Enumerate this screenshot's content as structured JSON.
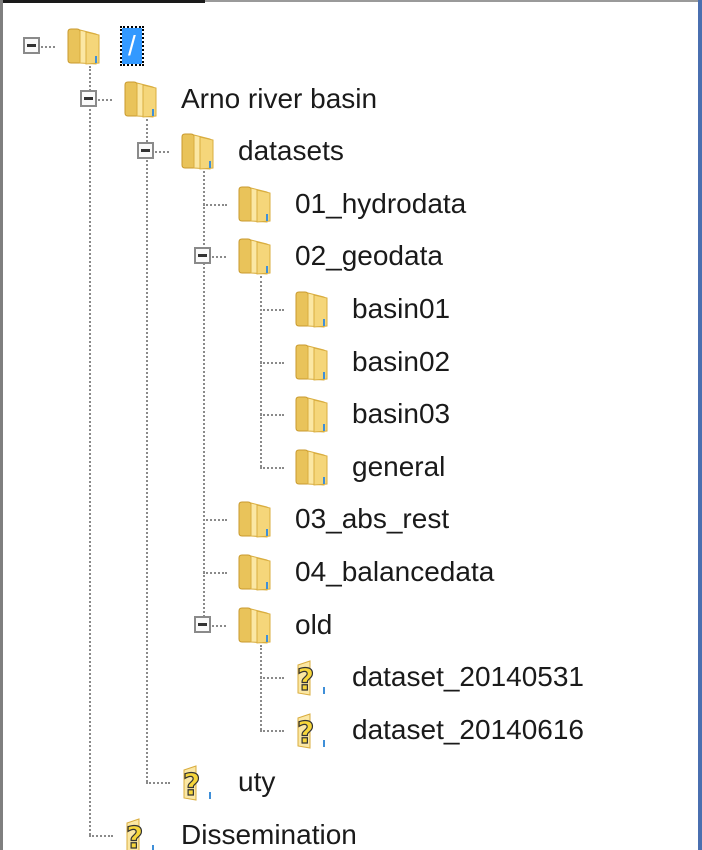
{
  "tree": {
    "nodes": [
      {
        "id": "root",
        "label": "/",
        "depth": 0,
        "icon": "folder",
        "expanded": true,
        "selected": true
      },
      {
        "id": "arno",
        "label": "Arno river basin",
        "depth": 1,
        "icon": "folder",
        "expanded": true
      },
      {
        "id": "datasets",
        "label": "datasets",
        "depth": 2,
        "icon": "folder",
        "expanded": true
      },
      {
        "id": "hydrodata",
        "label": "01_hydrodata",
        "depth": 3,
        "icon": "folder"
      },
      {
        "id": "geodata",
        "label": "02_geodata",
        "depth": 3,
        "icon": "folder",
        "expanded": true
      },
      {
        "id": "basin01",
        "label": "basin01",
        "depth": 4,
        "icon": "folder"
      },
      {
        "id": "basin02",
        "label": "basin02",
        "depth": 4,
        "icon": "folder"
      },
      {
        "id": "basin03",
        "label": "basin03",
        "depth": 4,
        "icon": "folder"
      },
      {
        "id": "general",
        "label": "general",
        "depth": 4,
        "icon": "folder"
      },
      {
        "id": "abs_rest",
        "label": "03_abs_rest",
        "depth": 3,
        "icon": "folder"
      },
      {
        "id": "balancedata",
        "label": "04_balancedata",
        "depth": 3,
        "icon": "folder"
      },
      {
        "id": "old",
        "label": "old",
        "depth": 3,
        "icon": "folder",
        "expanded": true
      },
      {
        "id": "ds0531",
        "label": "dataset_20140531",
        "depth": 4,
        "icon": "question"
      },
      {
        "id": "ds0616",
        "label": "dataset_20140616",
        "depth": 4,
        "icon": "question"
      },
      {
        "id": "uty",
        "label": "uty",
        "depth": 2,
        "icon": "question"
      },
      {
        "id": "dissemination",
        "label": "Dissemination",
        "depth": 1,
        "icon": "question"
      }
    ]
  },
  "colors": {
    "selection_bg": "#3399ff",
    "folder_light": "#fbe7a3",
    "folder_dark": "#e1b645",
    "question_yellow": "#f7d63a",
    "connector": "#8a8a8a"
  }
}
